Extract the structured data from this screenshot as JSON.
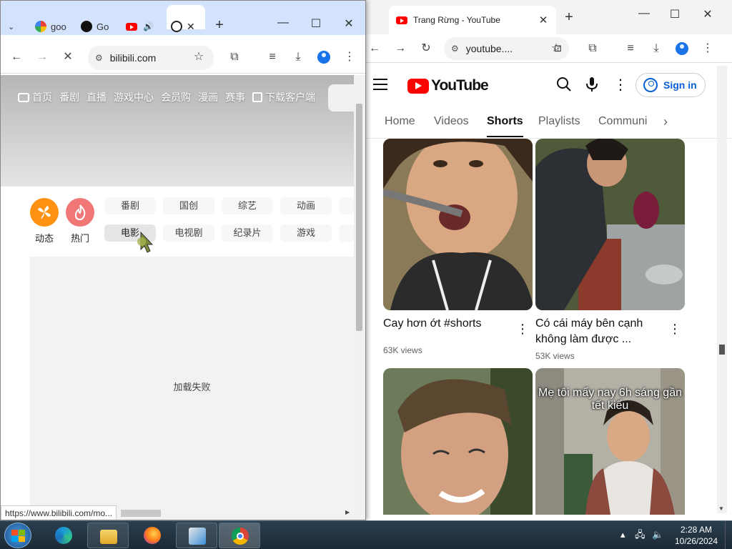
{
  "right_window": {
    "tab_title": "Trang Rừng - YouTube",
    "url": "youtube....",
    "brand": "YouTube",
    "signin_label": "Sign in",
    "tabs": [
      {
        "label": "Home"
      },
      {
        "label": "Videos"
      },
      {
        "label": "Shorts"
      },
      {
        "label": "Playlists"
      },
      {
        "label": "Communi"
      }
    ],
    "active_tab": "Shorts",
    "shorts": [
      {
        "title": "Cay hơn ớt #shorts",
        "views": "63K views"
      },
      {
        "title": "Có cái máy bên cạnh không làm được ...",
        "views": "53K views"
      },
      {
        "overlay": ""
      },
      {
        "overlay": "Mẹ tôi mấy nay 6h sáng gần tết kiểu"
      }
    ],
    "brand_red": "#FF0000",
    "link_blue": "#065FD4"
  },
  "left_window": {
    "tabs": [
      {
        "label": "goo",
        "icon": "google-g-icon"
      },
      {
        "label": "Go",
        "icon": "github-icon"
      },
      {
        "label": "",
        "icon": "youtube-icon"
      },
      {
        "label": "",
        "icon": "bilibili-icon"
      }
    ],
    "url": "bilibili.com",
    "nav": [
      "首页",
      "番剧",
      "直播",
      "游戏中心",
      "会员购",
      "漫画",
      "赛事",
      "下载客户端"
    ],
    "circle_buttons": [
      {
        "label": "动态",
        "color": "#FF9212"
      },
      {
        "label": "热门",
        "color": "#F07775"
      }
    ],
    "chips_row1": [
      "番剧",
      "国创",
      "综艺",
      "动画"
    ],
    "chips_row2": [
      "电影",
      "电视剧",
      "纪录片",
      "游戏"
    ],
    "load_failed": "加载失败",
    "status_url": "https://www.bilibili.com/mo..."
  },
  "taskbar": {
    "time": "2:28 AM",
    "date": "10/26/2024",
    "items": [
      "start-button",
      "edge",
      "file-explorer",
      "firefox",
      "app-installer",
      "chrome"
    ]
  }
}
